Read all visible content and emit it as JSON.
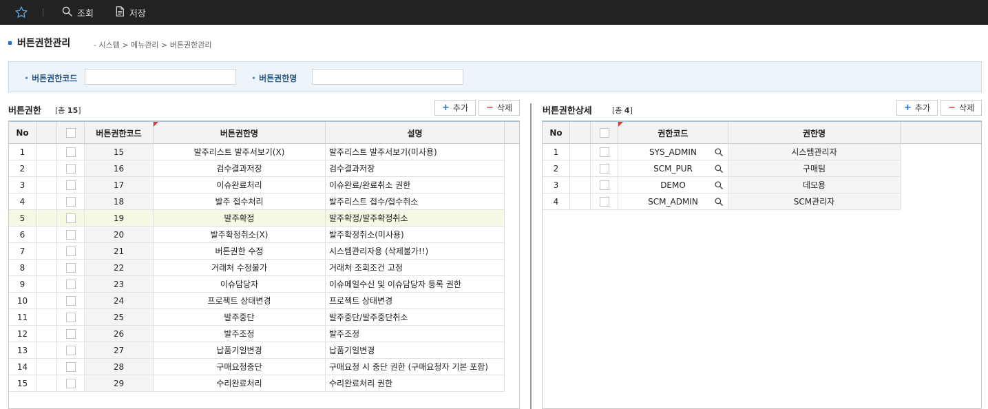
{
  "toolbar": {
    "favorite_icon": "star-icon",
    "search_label": "조회",
    "save_label": "저장"
  },
  "page": {
    "title": "버튼권한관리",
    "breadcrumb": "- 시스템 > 메뉴관리 > 버튼권한관리"
  },
  "search": {
    "code_label": "버튼권한코드",
    "code_value": "",
    "name_label": "버튼권한명",
    "name_value": ""
  },
  "left_grid": {
    "title": "버튼권한",
    "count_prefix": "[총 ",
    "count": "15",
    "count_suffix": "]",
    "add_label": "추가",
    "delete_label": "삭제",
    "columns": [
      "No",
      "",
      "",
      "버튼권한코드",
      "버튼권한명",
      "설명"
    ],
    "selected_row": 4,
    "rows": [
      {
        "no": "1",
        "code": "15",
        "name": "발주리스트 발주서보기(X)",
        "desc": "발주리스트 발주서보기(미사용)"
      },
      {
        "no": "2",
        "code": "16",
        "name": "검수결과저장",
        "desc": "검수결과저장"
      },
      {
        "no": "3",
        "code": "17",
        "name": "이슈완료처리",
        "desc": "이슈완료/완료취소 권한"
      },
      {
        "no": "4",
        "code": "18",
        "name": "발주 접수처리",
        "desc": "발주리스트 접수/접수취소"
      },
      {
        "no": "5",
        "code": "19",
        "name": "발주확정",
        "desc": "발주확정/발주확정취소"
      },
      {
        "no": "6",
        "code": "20",
        "name": "발주확정취소(X)",
        "desc": "발주확정취소(미사용)"
      },
      {
        "no": "7",
        "code": "21",
        "name": "버튼권한 수정",
        "desc": "시스템관리자용 (삭제불가!!)"
      },
      {
        "no": "8",
        "code": "22",
        "name": "거래처 수정불가",
        "desc": "거래처 조회조건 고정"
      },
      {
        "no": "9",
        "code": "23",
        "name": "이슈담당자",
        "desc": "이슈메일수신 및 이슈담당자 등록 권한"
      },
      {
        "no": "10",
        "code": "24",
        "name": "프로젝트 상태변경",
        "desc": "프로젝트 상태변경"
      },
      {
        "no": "11",
        "code": "25",
        "name": "발주중단",
        "desc": "발주중단/발주중단취소"
      },
      {
        "no": "12",
        "code": "26",
        "name": "발주조정",
        "desc": "발주조정"
      },
      {
        "no": "13",
        "code": "27",
        "name": "납품기일변경",
        "desc": "납품기일변경"
      },
      {
        "no": "14",
        "code": "28",
        "name": "구매요청중단",
        "desc": "구매요청 시 중단 권한 (구매요청자 기본 포함)"
      },
      {
        "no": "15",
        "code": "29",
        "name": "수리완료처리",
        "desc": "수리완료처리 권한"
      }
    ]
  },
  "right_grid": {
    "title": "버튼권한상세",
    "count_prefix": "[총 ",
    "count": "4",
    "count_suffix": "]",
    "add_label": "추가",
    "delete_label": "삭제",
    "columns": [
      "No",
      "",
      "",
      "권한코드",
      "권한명"
    ],
    "rows": [
      {
        "no": "1",
        "code": "SYS_ADMIN",
        "name": "시스템관리자"
      },
      {
        "no": "2",
        "code": "SCM_PUR",
        "name": "구매팀"
      },
      {
        "no": "3",
        "code": "DEMO",
        "name": "데모용"
      },
      {
        "no": "4",
        "code": "SCM_ADMIN",
        "name": "SCM관리자"
      }
    ]
  }
}
